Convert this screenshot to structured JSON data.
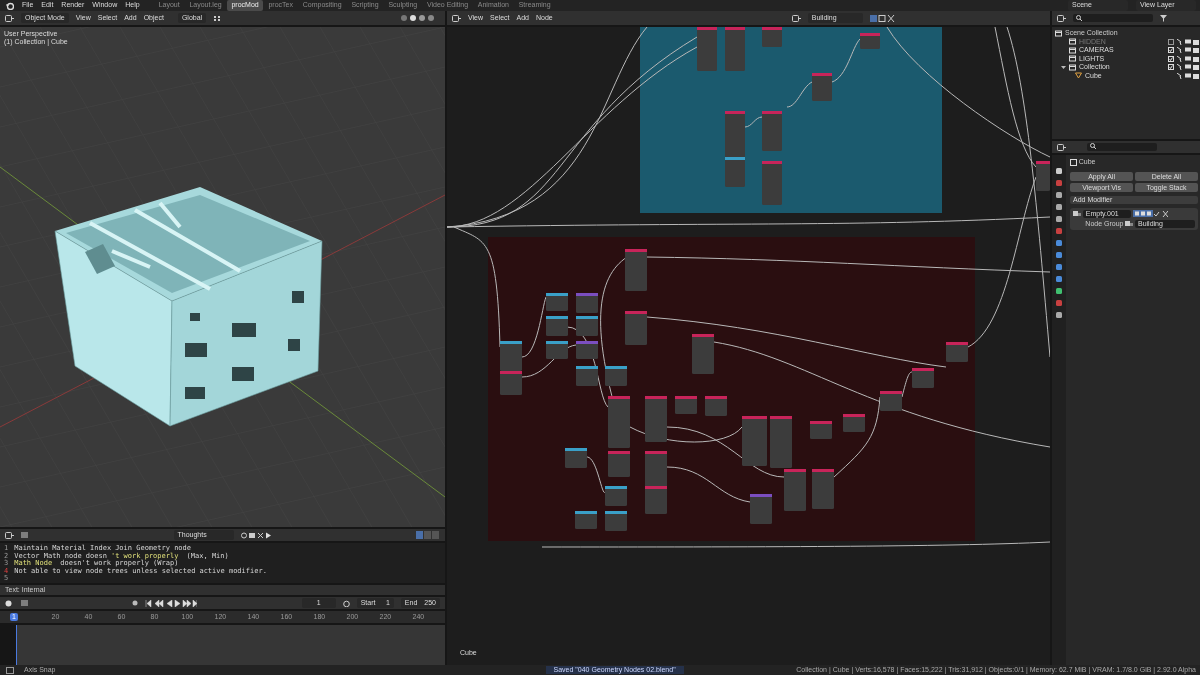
{
  "top_bar": {
    "menus": [
      "File",
      "Edit",
      "Render",
      "Window",
      "Help"
    ],
    "workspaces": [
      {
        "label": "Layout",
        "selected": false
      },
      {
        "label": "Layout.leg",
        "selected": false
      },
      {
        "label": "procMod",
        "selected": true
      },
      {
        "label": "procTex",
        "selected": false
      },
      {
        "label": "Compositing",
        "selected": false
      },
      {
        "label": "Scripting",
        "selected": false
      },
      {
        "label": "Sculpting",
        "selected": false
      },
      {
        "label": "Video Editing",
        "selected": false
      },
      {
        "label": "Animation",
        "selected": false
      },
      {
        "label": "Streaming",
        "selected": false
      }
    ],
    "scene": "Scene",
    "view_layer": "View Layer"
  },
  "viewport": {
    "mode": "Object Mode",
    "menus": [
      "View",
      "Select",
      "Add",
      "Object"
    ],
    "orientation": "Global",
    "overlay_lines": [
      "User Perspective",
      "(1) Collection | Cube"
    ]
  },
  "text_editor": {
    "text_name": "Thoughts",
    "lines": [
      {
        "number": "1",
        "error": false,
        "segments": [
          {
            "text": "Maintain Material Index",
            "kind": "plain"
          },
          {
            "text": "Join Geometry node",
            "kind": "plain"
          }
        ]
      },
      {
        "number": "2",
        "error": false,
        "segments": [
          {
            "text": "Vector Math node doesn",
            "kind": "plain"
          },
          {
            "text": "'t work properly",
            "kind": "keyword"
          },
          {
            "text": " (Max, Min)",
            "kind": "plain"
          }
        ]
      },
      {
        "number": "3",
        "error": false,
        "segments": [
          {
            "text": "Math Node",
            "kind": "keyword"
          },
          {
            "text": " doesn't work properly (Wrap)",
            "kind": "plain"
          }
        ]
      },
      {
        "number": "4",
        "error": true,
        "segments": [
          {
            "text": "Not able to view node trees unless selected",
            "kind": "plain"
          },
          {
            "text": "active modifier.",
            "kind": "plain"
          }
        ]
      },
      {
        "number": "5",
        "error": false
      }
    ],
    "footer": "Text: Internal"
  },
  "timeline": {
    "current_frame": "1",
    "start_label": "Start",
    "start": "1",
    "end_label": "End",
    "end": "250",
    "playhead": "1",
    "ticks": [
      "20",
      "40",
      "60",
      "80",
      "100",
      "120",
      "140",
      "160",
      "180",
      "200",
      "220",
      "240"
    ]
  },
  "node_editor": {
    "menus": [
      "View",
      "Select",
      "Add",
      "Node"
    ],
    "node_group": "Building",
    "object_label": "Cube"
  },
  "outliner": {
    "root": "Scene Collection",
    "items": [
      {
        "label": "HIDDEN",
        "checked": false
      },
      {
        "label": "CAMERAS",
        "checked": true
      },
      {
        "label": "LIGHTS",
        "checked": true
      },
      {
        "label": "Collection",
        "checked": true,
        "expanded": true,
        "children": [
          {
            "label": "Cube"
          }
        ]
      }
    ]
  },
  "properties": {
    "object": "Cube",
    "buttons": [
      "Apply All",
      "Delete All",
      "Viewport Vis",
      "Toggle Stack"
    ],
    "add_modifier": "Add Modifier",
    "modifier": {
      "name": "Empty.001",
      "field_label": "Node Group",
      "node_group": "Building"
    }
  },
  "status_bar": {
    "left": "Axis Snap",
    "message": "Saved \"040 Geometry Nodes 02.blend\"",
    "stats": "Collection | Cube | Verts:16,578 | Faces:15,222 | Tris:31,912 | Objects:0/1 | Memory: 62.7 MiB | VRAM: 1.7/8.0 GiB | 2.92.0 Alpha"
  }
}
